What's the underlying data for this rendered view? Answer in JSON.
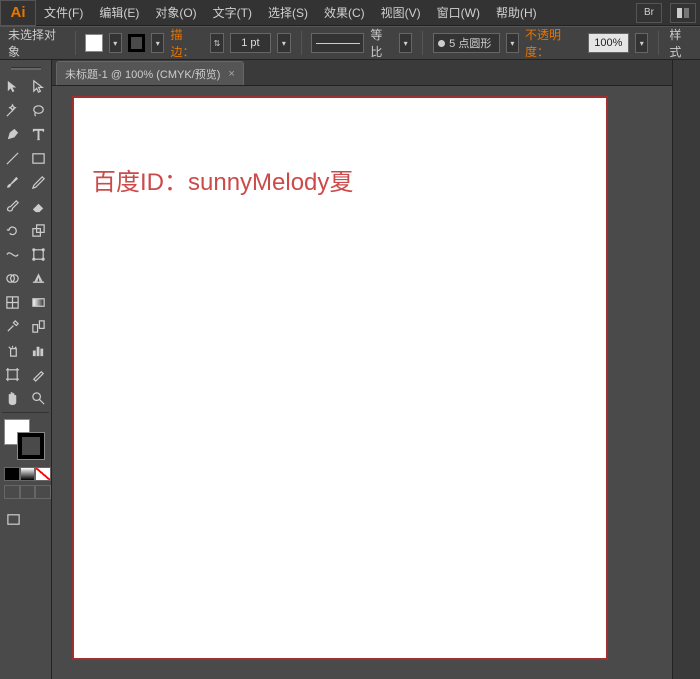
{
  "menu": {
    "items": [
      "文件(F)",
      "编辑(E)",
      "对象(O)",
      "文字(T)",
      "选择(S)",
      "效果(C)",
      "视图(V)",
      "窗口(W)",
      "帮助(H)"
    ],
    "bridge_label": "Br"
  },
  "options": {
    "no_selection": "未选择对象",
    "stroke_label": "描边：",
    "stroke_weight": "1 pt",
    "uniform": "等比",
    "profile_pt": "5 点圆形",
    "opacity_label": "不透明度：",
    "opacity_value": "100%",
    "style_label": "样式"
  },
  "document": {
    "tab_title": "未标题-1 @ 100% (CMYK/预览)",
    "canvas_text": "百度ID：sunnyMelody夏"
  },
  "colors": {
    "accent": "#e87500",
    "artboard_border": "#a03030",
    "canvas_text": "#cc4a4a"
  }
}
